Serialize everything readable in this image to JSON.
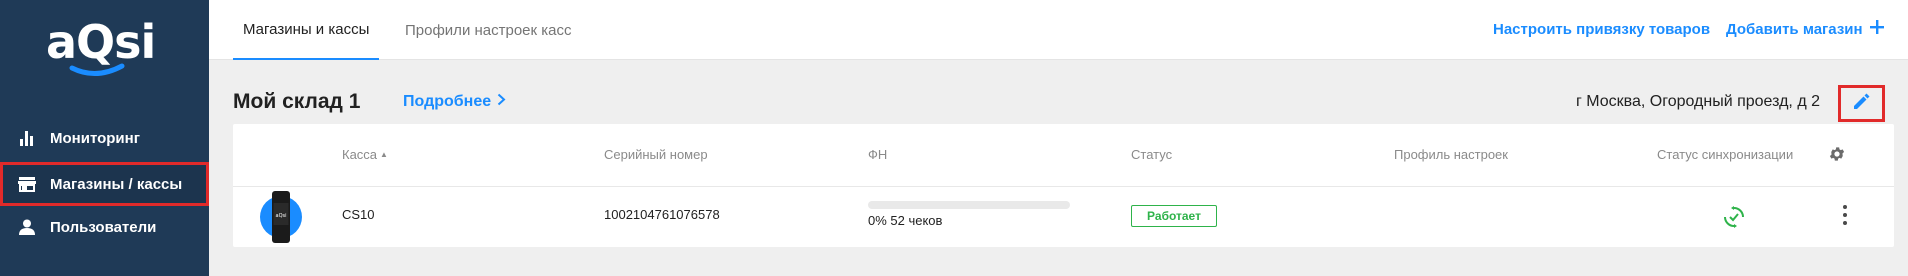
{
  "brand": {
    "logo_text": "aQsi"
  },
  "sidebar": {
    "items": [
      {
        "label": "Мониторинг",
        "icon": "chart-bars-icon"
      },
      {
        "label": "Магазины / кассы",
        "icon": "store-icon",
        "active": true
      },
      {
        "label": "Пользователи",
        "icon": "user-icon"
      }
    ]
  },
  "tabs": [
    {
      "label": "Магазины и кассы",
      "active": true
    },
    {
      "label": "Профили настроек касс",
      "active": false
    }
  ],
  "toolbar": {
    "configure_label": "Настроить привязку товаров",
    "add_store_label": "Добавить магазин"
  },
  "store": {
    "title": "Мой склад 1",
    "details_label": "Подробнее",
    "address": "г Москва, Огородный проезд, д 2"
  },
  "table": {
    "columns": [
      "Касса",
      "Серийный номер",
      "ФН",
      "Статус",
      "Профиль настроек",
      "Статус синхронизации"
    ],
    "sort_indicator": "▲",
    "rows": [
      {
        "device_screen_text": "aQsi",
        "kassa": "CS10",
        "serial": "1002104761076578",
        "fn_progress": 0,
        "fn_text": "0% 52 чеков",
        "status": "Работает",
        "profile": "",
        "sync": "synced-icon"
      }
    ]
  },
  "colors": {
    "sidebar_bg": "#1f3a57",
    "accent": "#1a8cff",
    "success": "#2eb34a",
    "highlight": "#e12a2a"
  }
}
